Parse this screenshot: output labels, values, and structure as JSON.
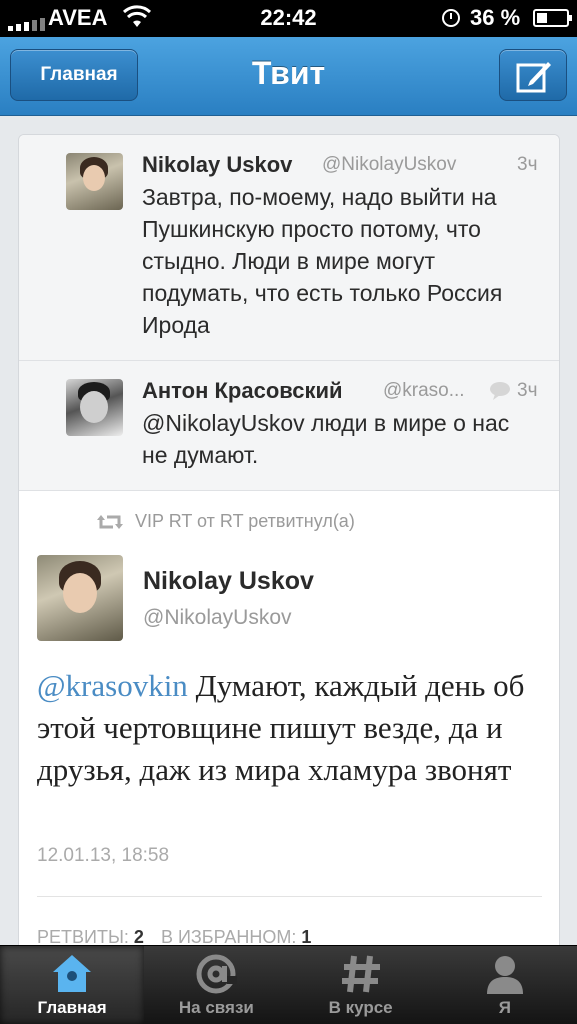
{
  "status_bar": {
    "carrier": "AVEA",
    "time": "22:42",
    "battery": "36 %"
  },
  "nav": {
    "back_label": "Главная",
    "title": "Твит"
  },
  "conversation": [
    {
      "name": "Nikolay Uskov",
      "handle": "@NikolayUskov",
      "time_ago": "3ч",
      "text": "Завтра, по-моему, надо выйти на Пушкинскую просто потому, что стыдно. Люди в мире могут подумать, что есть только Россия Ирода"
    },
    {
      "name": "Антон Красовский",
      "handle": "@kraso...",
      "time_ago": "3ч",
      "text": "@NikolayUskov люди в мире о нас не думают."
    }
  ],
  "retweet_info": "VIP RT от RT ретвитнул(а)",
  "main_tweet": {
    "name": "Nikolay Uskov",
    "handle": "@NikolayUskov",
    "mention": "@krasovkin",
    "text": " Думают, каждый день об этой чертовщине пишут везде, да и друзья, даж из мира хламура звонят",
    "timestamp": "12.01.13, 18:58",
    "retweets_label": "Ретвиты:",
    "retweets_count": "2",
    "favorites_label": "В избранном:",
    "favorites_count": "1"
  },
  "tabs": [
    {
      "label": "Главная",
      "icon": "home-icon",
      "active": true
    },
    {
      "label": "На связи",
      "icon": "at-icon",
      "active": false
    },
    {
      "label": "В курсе",
      "icon": "hash-icon",
      "active": false
    },
    {
      "label": "Я",
      "icon": "person-icon",
      "active": false
    }
  ],
  "colors": {
    "nav_blue": "#2a7fc2",
    "mention_blue": "#4a8cc4",
    "home_icon_blue": "#5ab4ef"
  }
}
